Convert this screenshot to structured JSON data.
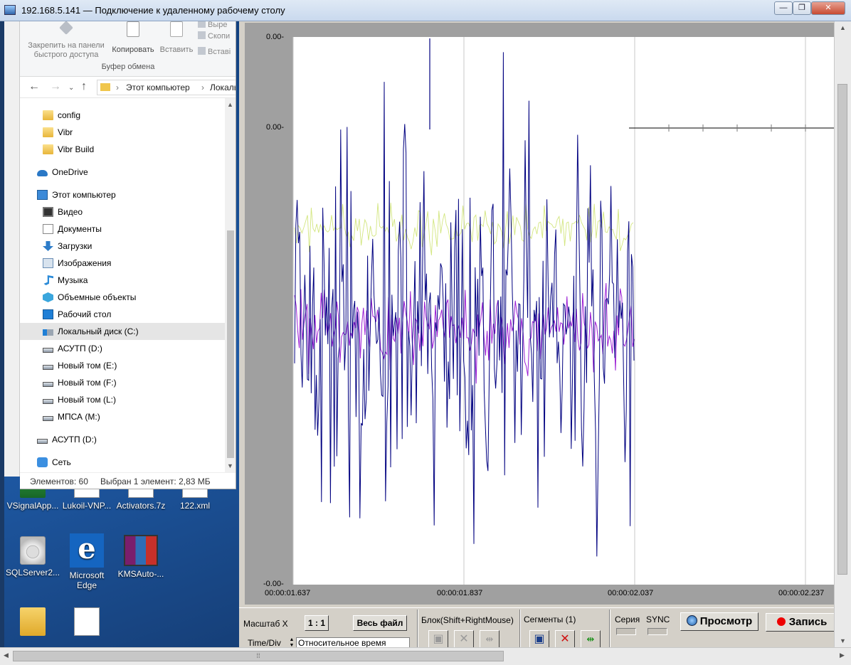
{
  "rdp": {
    "title": "192.168.5.141 — Подключение к удаленному рабочему столу",
    "min": "—",
    "max": "❐",
    "close": "✕"
  },
  "explorer": {
    "ribbon": {
      "pin": "Закрепить на панели быстрого доступа",
      "copy": "Копировать",
      "paste": "Вставить",
      "cut": "Выре",
      "copy_path": "Скопи",
      "paste_shortcut": "Вставі",
      "group": "Буфер обмена"
    },
    "address": {
      "crumbs": [
        "Этот компьютер",
        "Локаль"
      ]
    },
    "tree": [
      {
        "label": "config",
        "icon": "folder-icon"
      },
      {
        "label": "Vibr",
        "icon": "folder-icon"
      },
      {
        "label": "Vibr Build",
        "icon": "folder-icon"
      },
      {
        "label": "OneDrive",
        "icon": "cloud-icon"
      },
      {
        "label": "Этот компьютер",
        "icon": "computer-icon"
      },
      {
        "label": "Видео",
        "icon": "video-icon"
      },
      {
        "label": "Документы",
        "icon": "document-icon"
      },
      {
        "label": "Загрузки",
        "icon": "download-icon"
      },
      {
        "label": "Изображения",
        "icon": "image-icon"
      },
      {
        "label": "Музыка",
        "icon": "music-icon"
      },
      {
        "label": "Объемные объекты",
        "icon": "3d-objects-icon"
      },
      {
        "label": "Рабочий стол",
        "icon": "desktop-icon"
      },
      {
        "label": "Локальный диск (C:)",
        "icon": "system-drive-icon"
      },
      {
        "label": "АСУТП (D:)",
        "icon": "drive-icon"
      },
      {
        "label": "Новый том (E:)",
        "icon": "drive-icon"
      },
      {
        "label": "Новый том (F:)",
        "icon": "drive-icon"
      },
      {
        "label": "Новый том (L:)",
        "icon": "drive-icon"
      },
      {
        "label": "МПСА (M:)",
        "icon": "network-drive-icon"
      },
      {
        "label": "АСУТП (D:)",
        "icon": "drive-icon"
      },
      {
        "label": "Сеть",
        "icon": "network-icon"
      }
    ],
    "status": {
      "count": "Элементов: 60",
      "selected": "Выбран 1 элемент: 2,83 МБ"
    }
  },
  "desktop": {
    "icons": [
      {
        "label": "VSignalApp...",
        "icon": "app-icon"
      },
      {
        "label": "Lukoil-VNP...",
        "icon": "file-icon"
      },
      {
        "label": "Activators.7z",
        "icon": "archive-icon"
      },
      {
        "label": "122.xml",
        "icon": "xml-file-icon"
      },
      {
        "label": "SQLServer2...",
        "icon": "disc-icon"
      },
      {
        "label": "Microsoft Edge",
        "icon": "edge-icon"
      },
      {
        "label": "KMSAuto-...",
        "icon": "winrar-icon"
      }
    ]
  },
  "app": {
    "y_labels": {
      "top": "0.00-",
      "mid": "0.00-",
      "bottom": "-0.00-"
    },
    "x_labels": [
      "00:00:01.637",
      "00:00:01.837",
      "00:00:02.037",
      "00:00:02.237"
    ],
    "controls": {
      "scale_label": "Масштаб X",
      "ratio_button": "1 : 1",
      "whole_file_button": "Весь файл",
      "timediv_label": "Time/Div",
      "timediv_value": "Относительное время",
      "block_label": "Блок(Shift+RightMouse)",
      "segments_label": "Сегменты (1)",
      "series_label": "Серия",
      "sync_label": "SYNC",
      "view_button": "Просмотр",
      "record_button": "Запись"
    }
  },
  "chart_data": {
    "type": "line",
    "x": [
      "00:00:01.637",
      "00:00:01.837",
      "00:00:02.037",
      "00:00:02.237"
    ],
    "series": [
      {
        "values": [],
        "color": "#000080"
      },
      {
        "values": [],
        "color": "#9c20d4"
      },
      {
        "values": [],
        "color": "#c8e060"
      }
    ],
    "grid": true,
    "signal_end": "00:00:02.037"
  }
}
